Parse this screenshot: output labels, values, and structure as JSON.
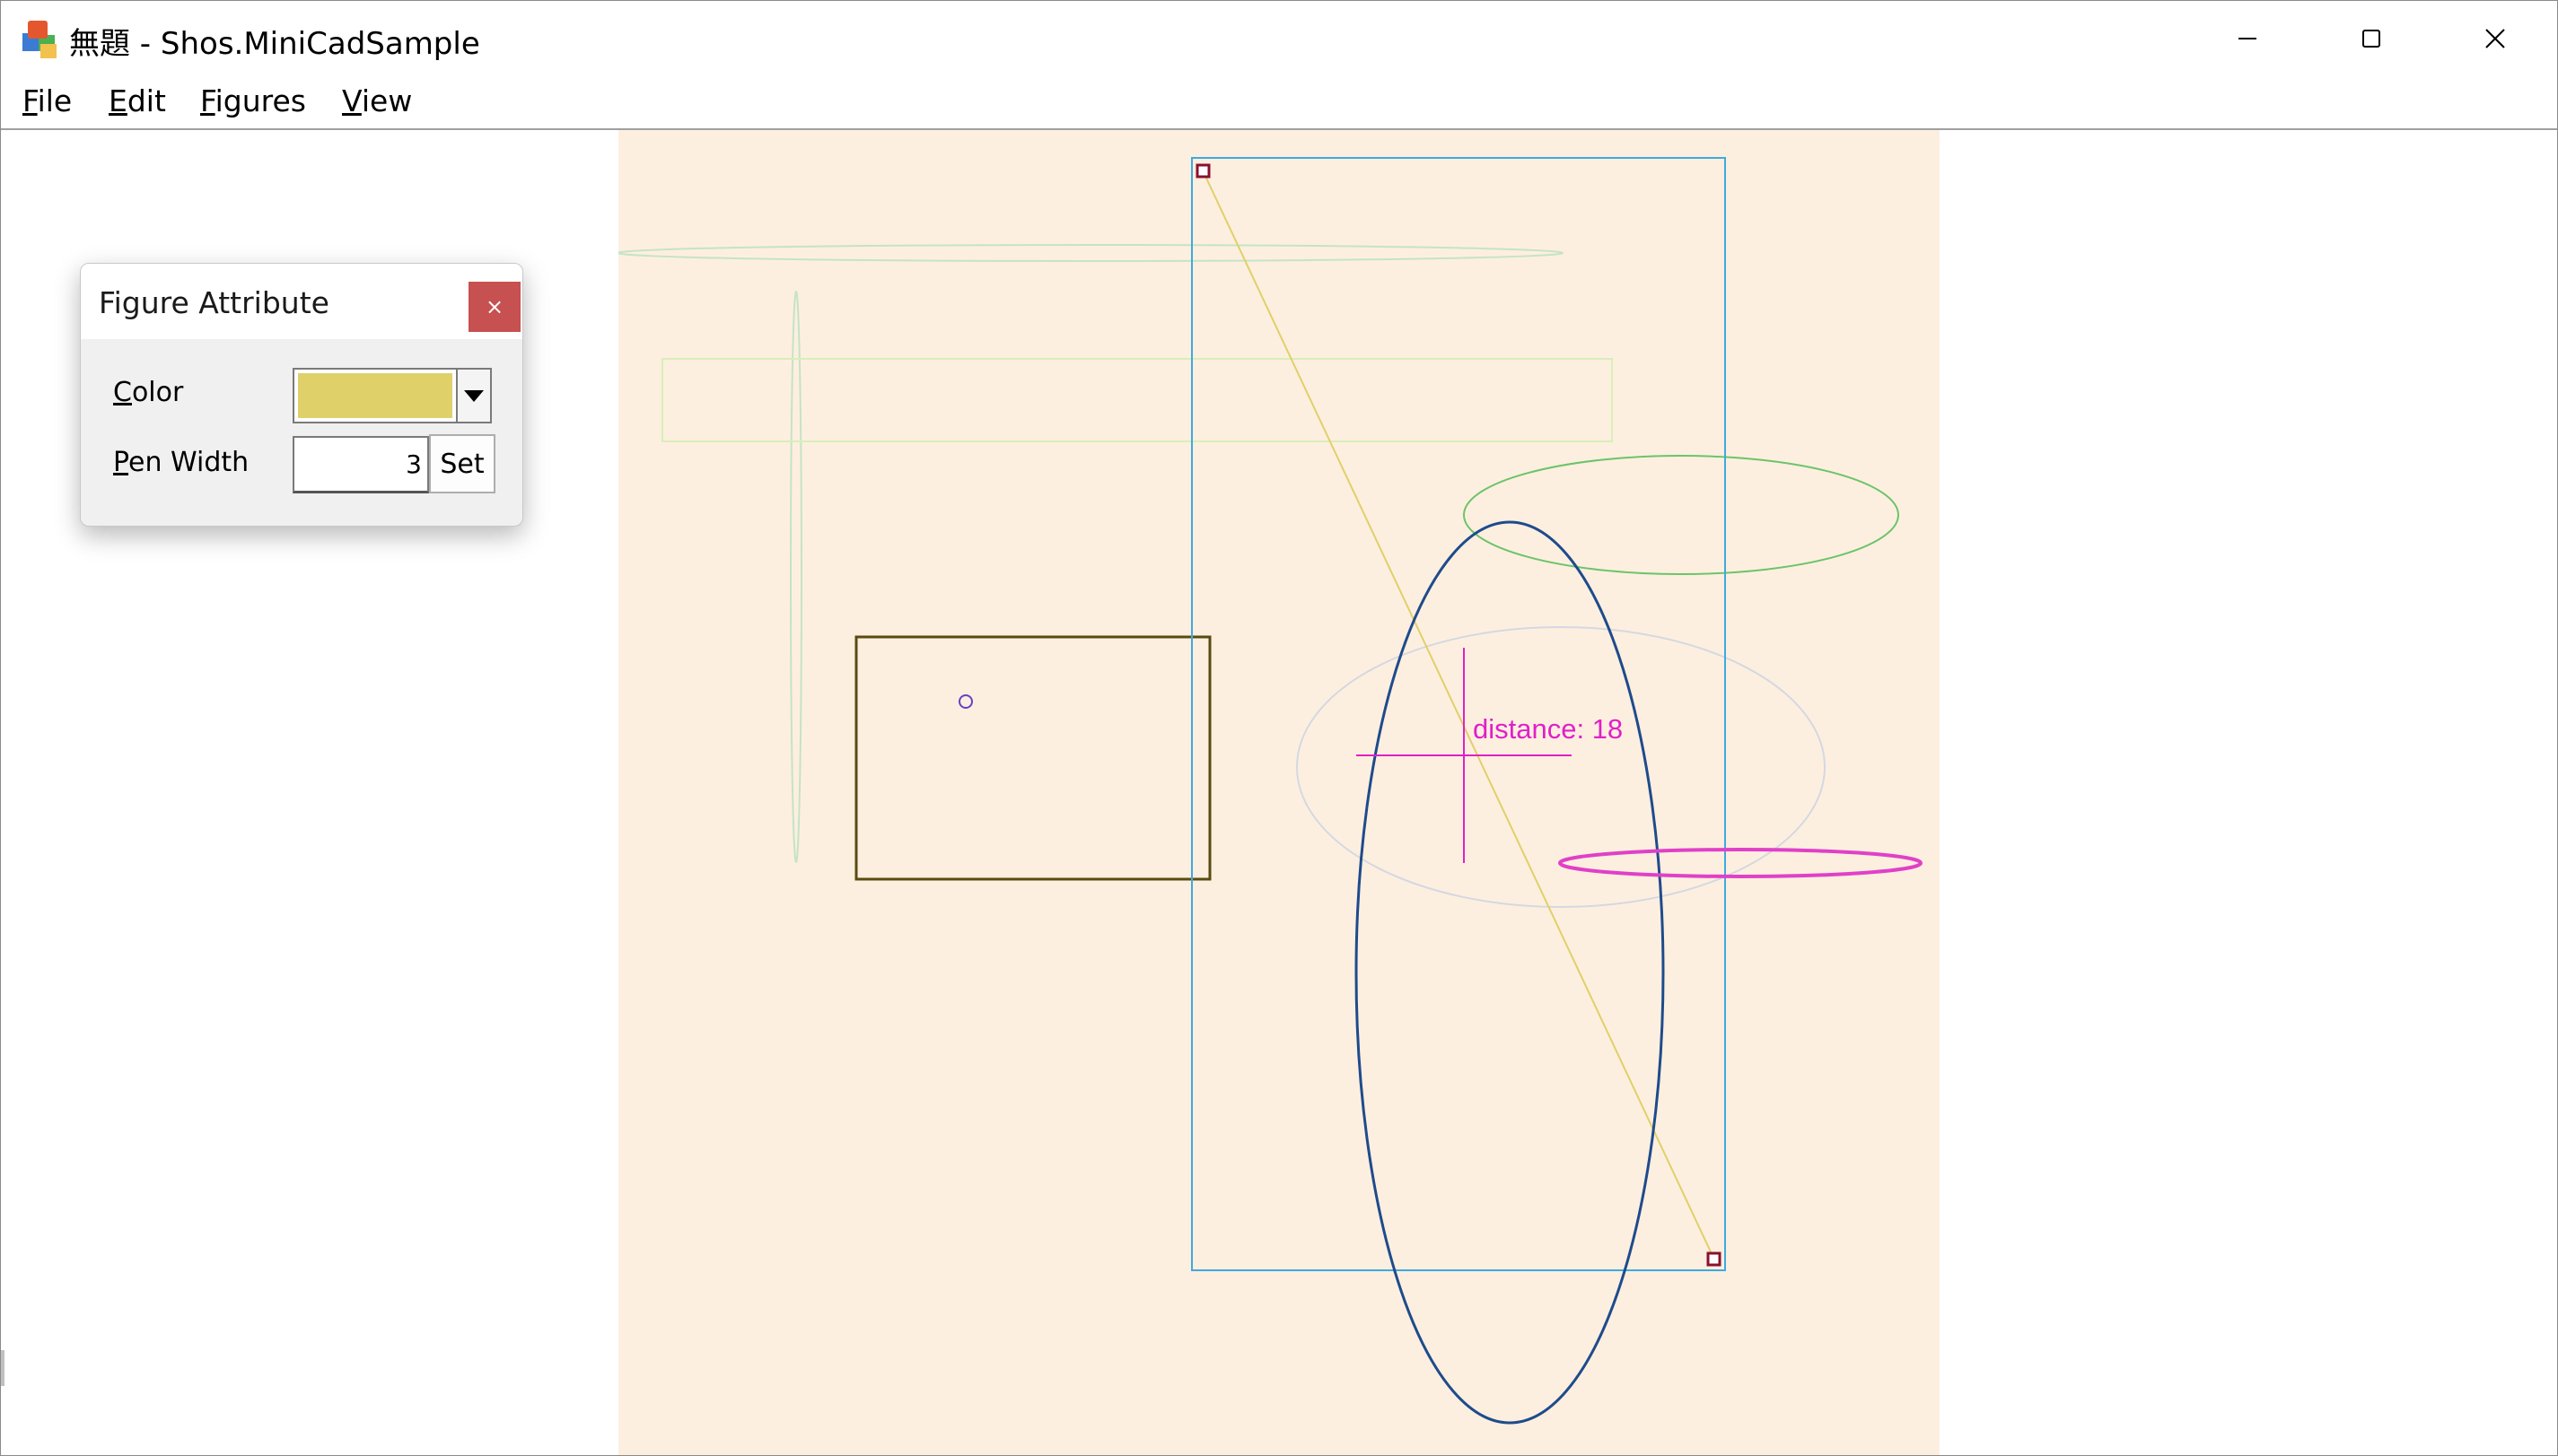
{
  "window": {
    "title": "無題 - Shos.MiniCadSample"
  },
  "menu": {
    "items": [
      {
        "label_first": "F",
        "label_rest": "ile"
      },
      {
        "label_first": "E",
        "label_rest": "dit"
      },
      {
        "label_first": "F",
        "label_rest": "igures"
      },
      {
        "label_first": "V",
        "label_rest": "iew"
      }
    ]
  },
  "dialog": {
    "title": "Figure Attribute",
    "close_glyph": "×",
    "color_label_first": "C",
    "color_label_rest": "olor",
    "pen_label_first": "P",
    "pen_label_rest": "en Width",
    "pen_width_value": "3",
    "set_label": "Set",
    "selected_color": "#e0d06a"
  },
  "canvas": {
    "background": "#fdefdf",
    "distance_text": "distance: 18"
  },
  "icons": {
    "app": "app-icon",
    "minimize": "minimize-icon",
    "maximize": "maximize-icon",
    "close": "close-icon",
    "dropdown": "chevron-down-icon"
  }
}
